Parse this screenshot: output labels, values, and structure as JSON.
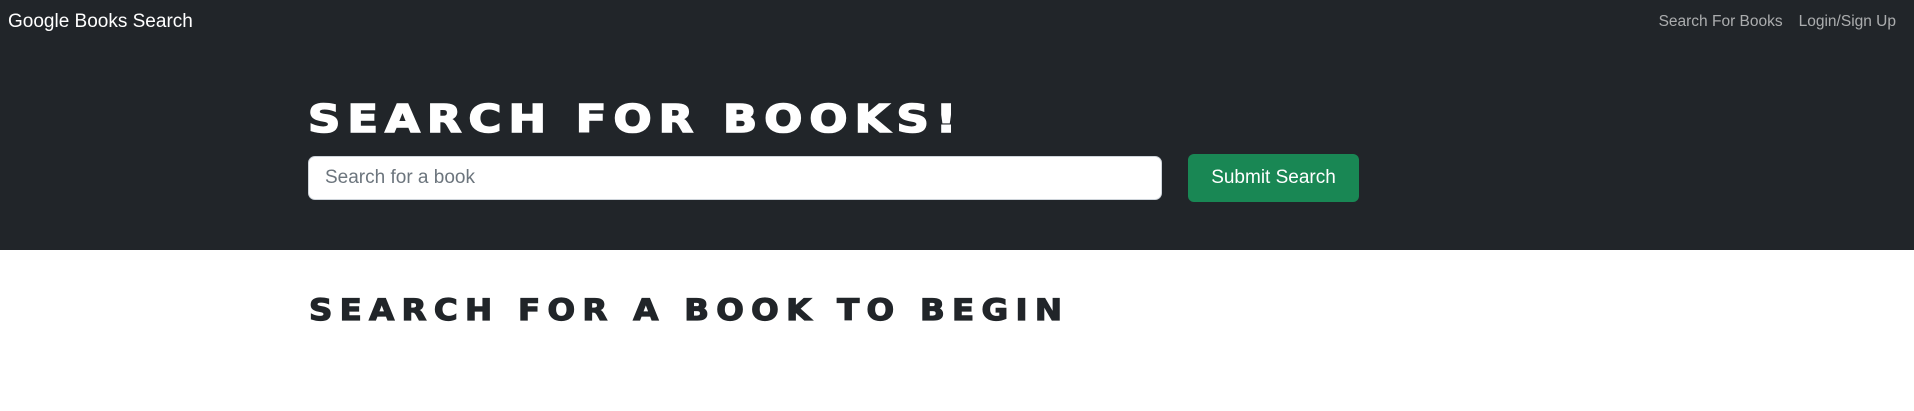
{
  "navbar": {
    "brand": "Google Books Search",
    "links": [
      {
        "label": "Search For Books"
      },
      {
        "label": "Login/Sign Up"
      }
    ]
  },
  "hero": {
    "title": "SEARCH FOR BOOKS!"
  },
  "search": {
    "placeholder": "Search for a book",
    "value": "",
    "submit_label": "Submit Search"
  },
  "results": {
    "heading": "SEARCH FOR A BOOK TO BEGIN"
  },
  "colors": {
    "header_bg": "#212529",
    "submit_bg": "#198754",
    "page_bg": "#ffffff"
  }
}
